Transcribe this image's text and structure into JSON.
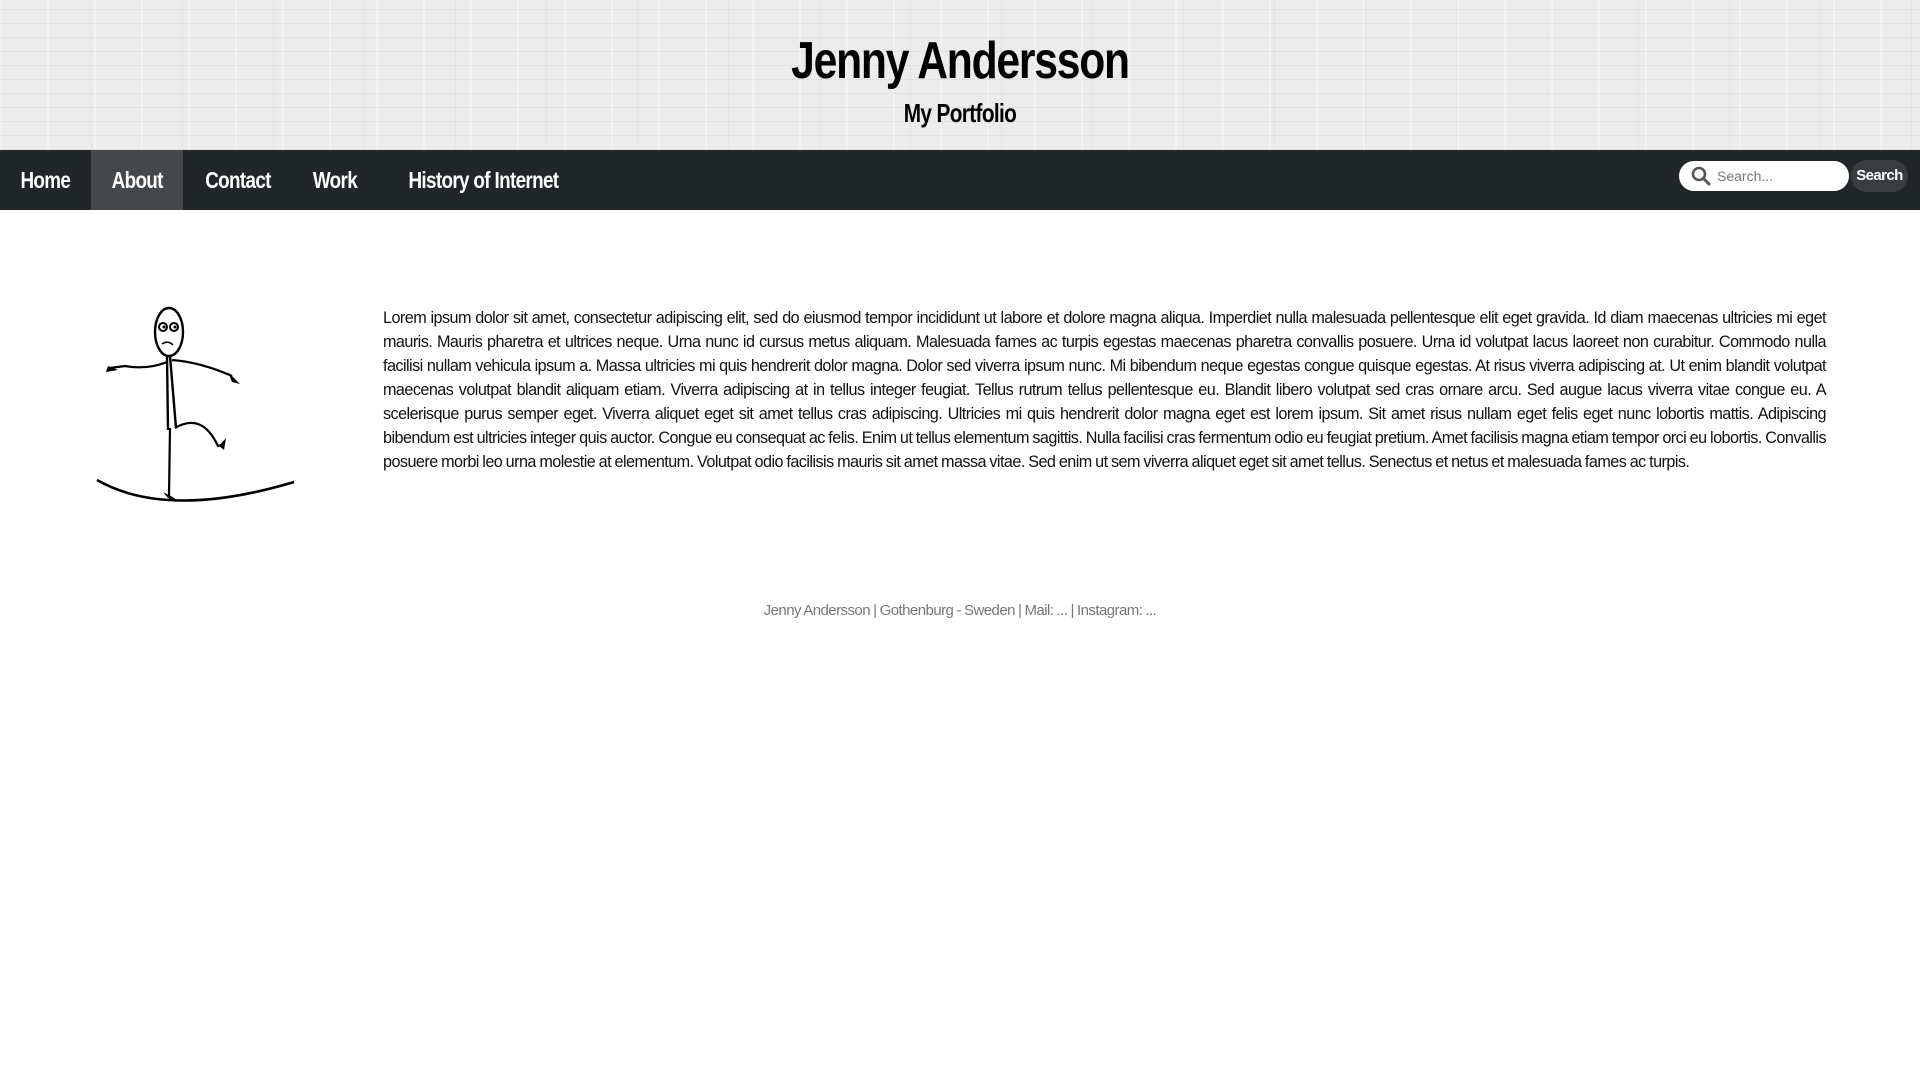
{
  "header": {
    "title": "Jenny Andersson",
    "subtitle": "My Portfolio"
  },
  "nav": {
    "items": [
      {
        "label": "Home",
        "active": false
      },
      {
        "label": "About",
        "active": true
      },
      {
        "label": "Contact",
        "active": false
      },
      {
        "label": "Work",
        "active": false
      },
      {
        "label": "History of Internet",
        "active": false
      }
    ],
    "search": {
      "placeholder": "Search...",
      "value": "",
      "button_label": "Search",
      "icon": "search-icon"
    }
  },
  "main": {
    "image": "stickman-balancing-illustration",
    "paragraph": "Lorem ipsum dolor sit amet, consectetur adipiscing elit, sed do eiusmod tempor incididunt ut labore et dolore magna aliqua. Imperdiet nulla malesuada pellentesque elit eget gravida. Id diam maecenas ultricies mi eget mauris. Mauris pharetra et ultrices neque. Urna nunc id cursus metus aliquam. Malesuada fames ac turpis egestas maecenas pharetra convallis posuere. Urna id volutpat lacus laoreet non curabitur. Commodo nulla facilisi nullam vehicula ipsum a. Massa ultricies mi quis hendrerit dolor magna. Dolor sed viverra ipsum nunc. Mi bibendum neque egestas congue quisque egestas. At risus viverra adipiscing at. Ut enim blandit volutpat maecenas volutpat blandit aliquam etiam. Viverra adipiscing at in tellus integer feugiat. Tellus rutrum tellus pellentesque eu. Blandit libero volutpat sed cras ornare arcu. Sed augue lacus viverra vitae congue eu. A scelerisque purus semper eget. Viverra aliquet eget sit amet tellus cras adipiscing. Ultricies mi quis hendrerit dolor magna eget est lorem ipsum. Sit amet risus nullam eget felis eget nunc lobortis mattis. Adipiscing bibendum est ultricies integer quis auctor. Congue eu consequat ac felis. Enim ut tellus elementum sagittis. Nulla facilisi cras fermentum odio eu feugiat pretium. Amet facilisis magna etiam tempor orci eu lobortis. Convallis posuere morbi leo urna molestie at elementum. Volutpat odio facilisis mauris sit amet massa vitae. Sed enim ut sem viverra aliquet eget sit amet tellus. Senectus et netus et malesuada fames ac turpis."
  },
  "footer": {
    "text": "Jenny Andersson | Gothenburg - Sweden | Mail: ... | Instagram: ..."
  },
  "colors": {
    "navbar_bg": "#212629",
    "nav_active_bg": "#45484a",
    "header_bg": "#ececec",
    "footer_text": "#777777"
  }
}
